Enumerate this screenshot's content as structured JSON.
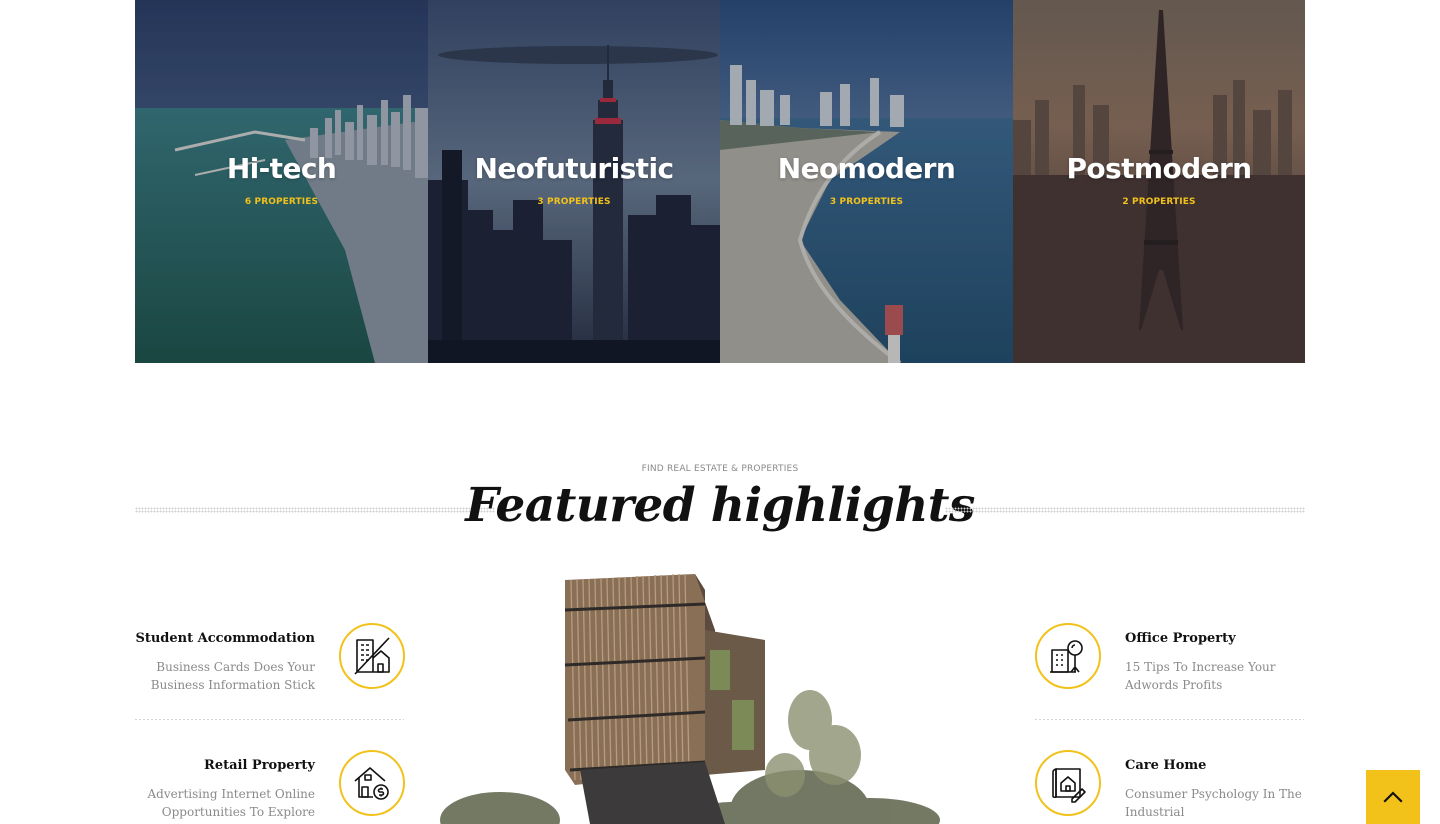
{
  "categories": [
    {
      "title": "Hi-tech",
      "count": "6 PROPERTIES",
      "image": "chicago-lakefront-skyline"
    },
    {
      "title": "Neofuturistic",
      "count": "3 PROPERTIES",
      "image": "new-york-empire-state-skyline"
    },
    {
      "title": "Neomodern",
      "count": "3 PROPERTIES",
      "image": "miami-beach-shoreline"
    },
    {
      "title": "Postmodern",
      "count": "2 PROPERTIES",
      "image": "paris-eiffel-tower-skyline"
    }
  ],
  "featured": {
    "eyebrow": "FIND REAL ESTATE & PROPERTIES",
    "title": "Featured highlights",
    "items": [
      {
        "title": "Student Accommodation",
        "description": "Business Cards Does Your Business Information Stick",
        "icon": "apartment-building-icon"
      },
      {
        "title": "Office Property",
        "description": "15 Tips To Increase Your Adwords Profits",
        "icon": "office-search-icon"
      },
      {
        "title": "Retail Property",
        "description": "Advertising Internet Online Opportunities To Explore",
        "icon": "house-money-icon"
      },
      {
        "title": "Care Home",
        "description": "Consumer Psychology In The Industrial",
        "icon": "house-plan-icon"
      }
    ],
    "image": "modern-tower-illustration"
  },
  "scroll_top": {
    "icon": "chevron-up-icon"
  },
  "colors": {
    "accent": "#f2c21b",
    "heading": "#111111",
    "muted": "#8a8a8a"
  }
}
